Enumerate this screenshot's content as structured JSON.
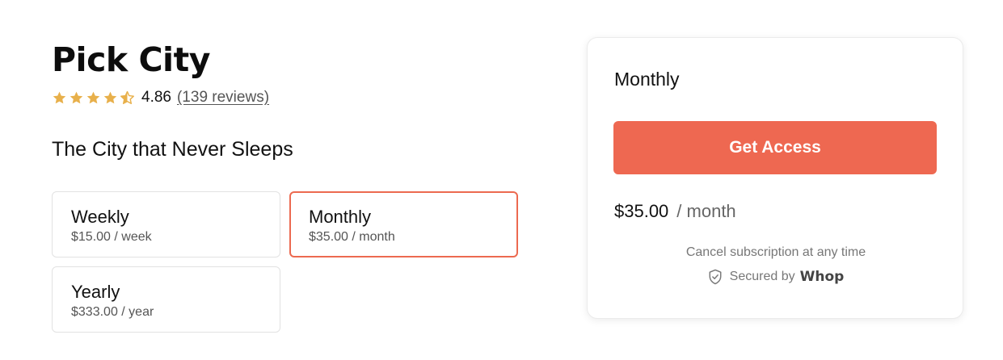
{
  "product": {
    "title": "Pick City",
    "rating_value": "4.86",
    "reviews_label": "(139 reviews)",
    "rating_stars": 4.86,
    "tagline": "The City that Never Sleeps"
  },
  "plans": [
    {
      "name": "Weekly",
      "price": "$15.00 / week",
      "selected": false
    },
    {
      "name": "Monthly",
      "price": "$35.00 / month",
      "selected": true
    },
    {
      "name": "Yearly",
      "price": "$333.00 / year",
      "selected": false
    }
  ],
  "checkout": {
    "plan_title": "Monthly",
    "cta_label": "Get Access",
    "price_amount": "$35.00",
    "price_period": "/ month",
    "cancel_note": "Cancel subscription at any time",
    "secured_label": "Secured by",
    "brand": "Whop"
  },
  "icons": {
    "star": "star-icon",
    "half_star": "half-star-icon",
    "shield": "shield-check-icon"
  },
  "colors": {
    "accent": "#ee6851",
    "star": "#e8b04b",
    "selected_border": "#ec6a50"
  }
}
